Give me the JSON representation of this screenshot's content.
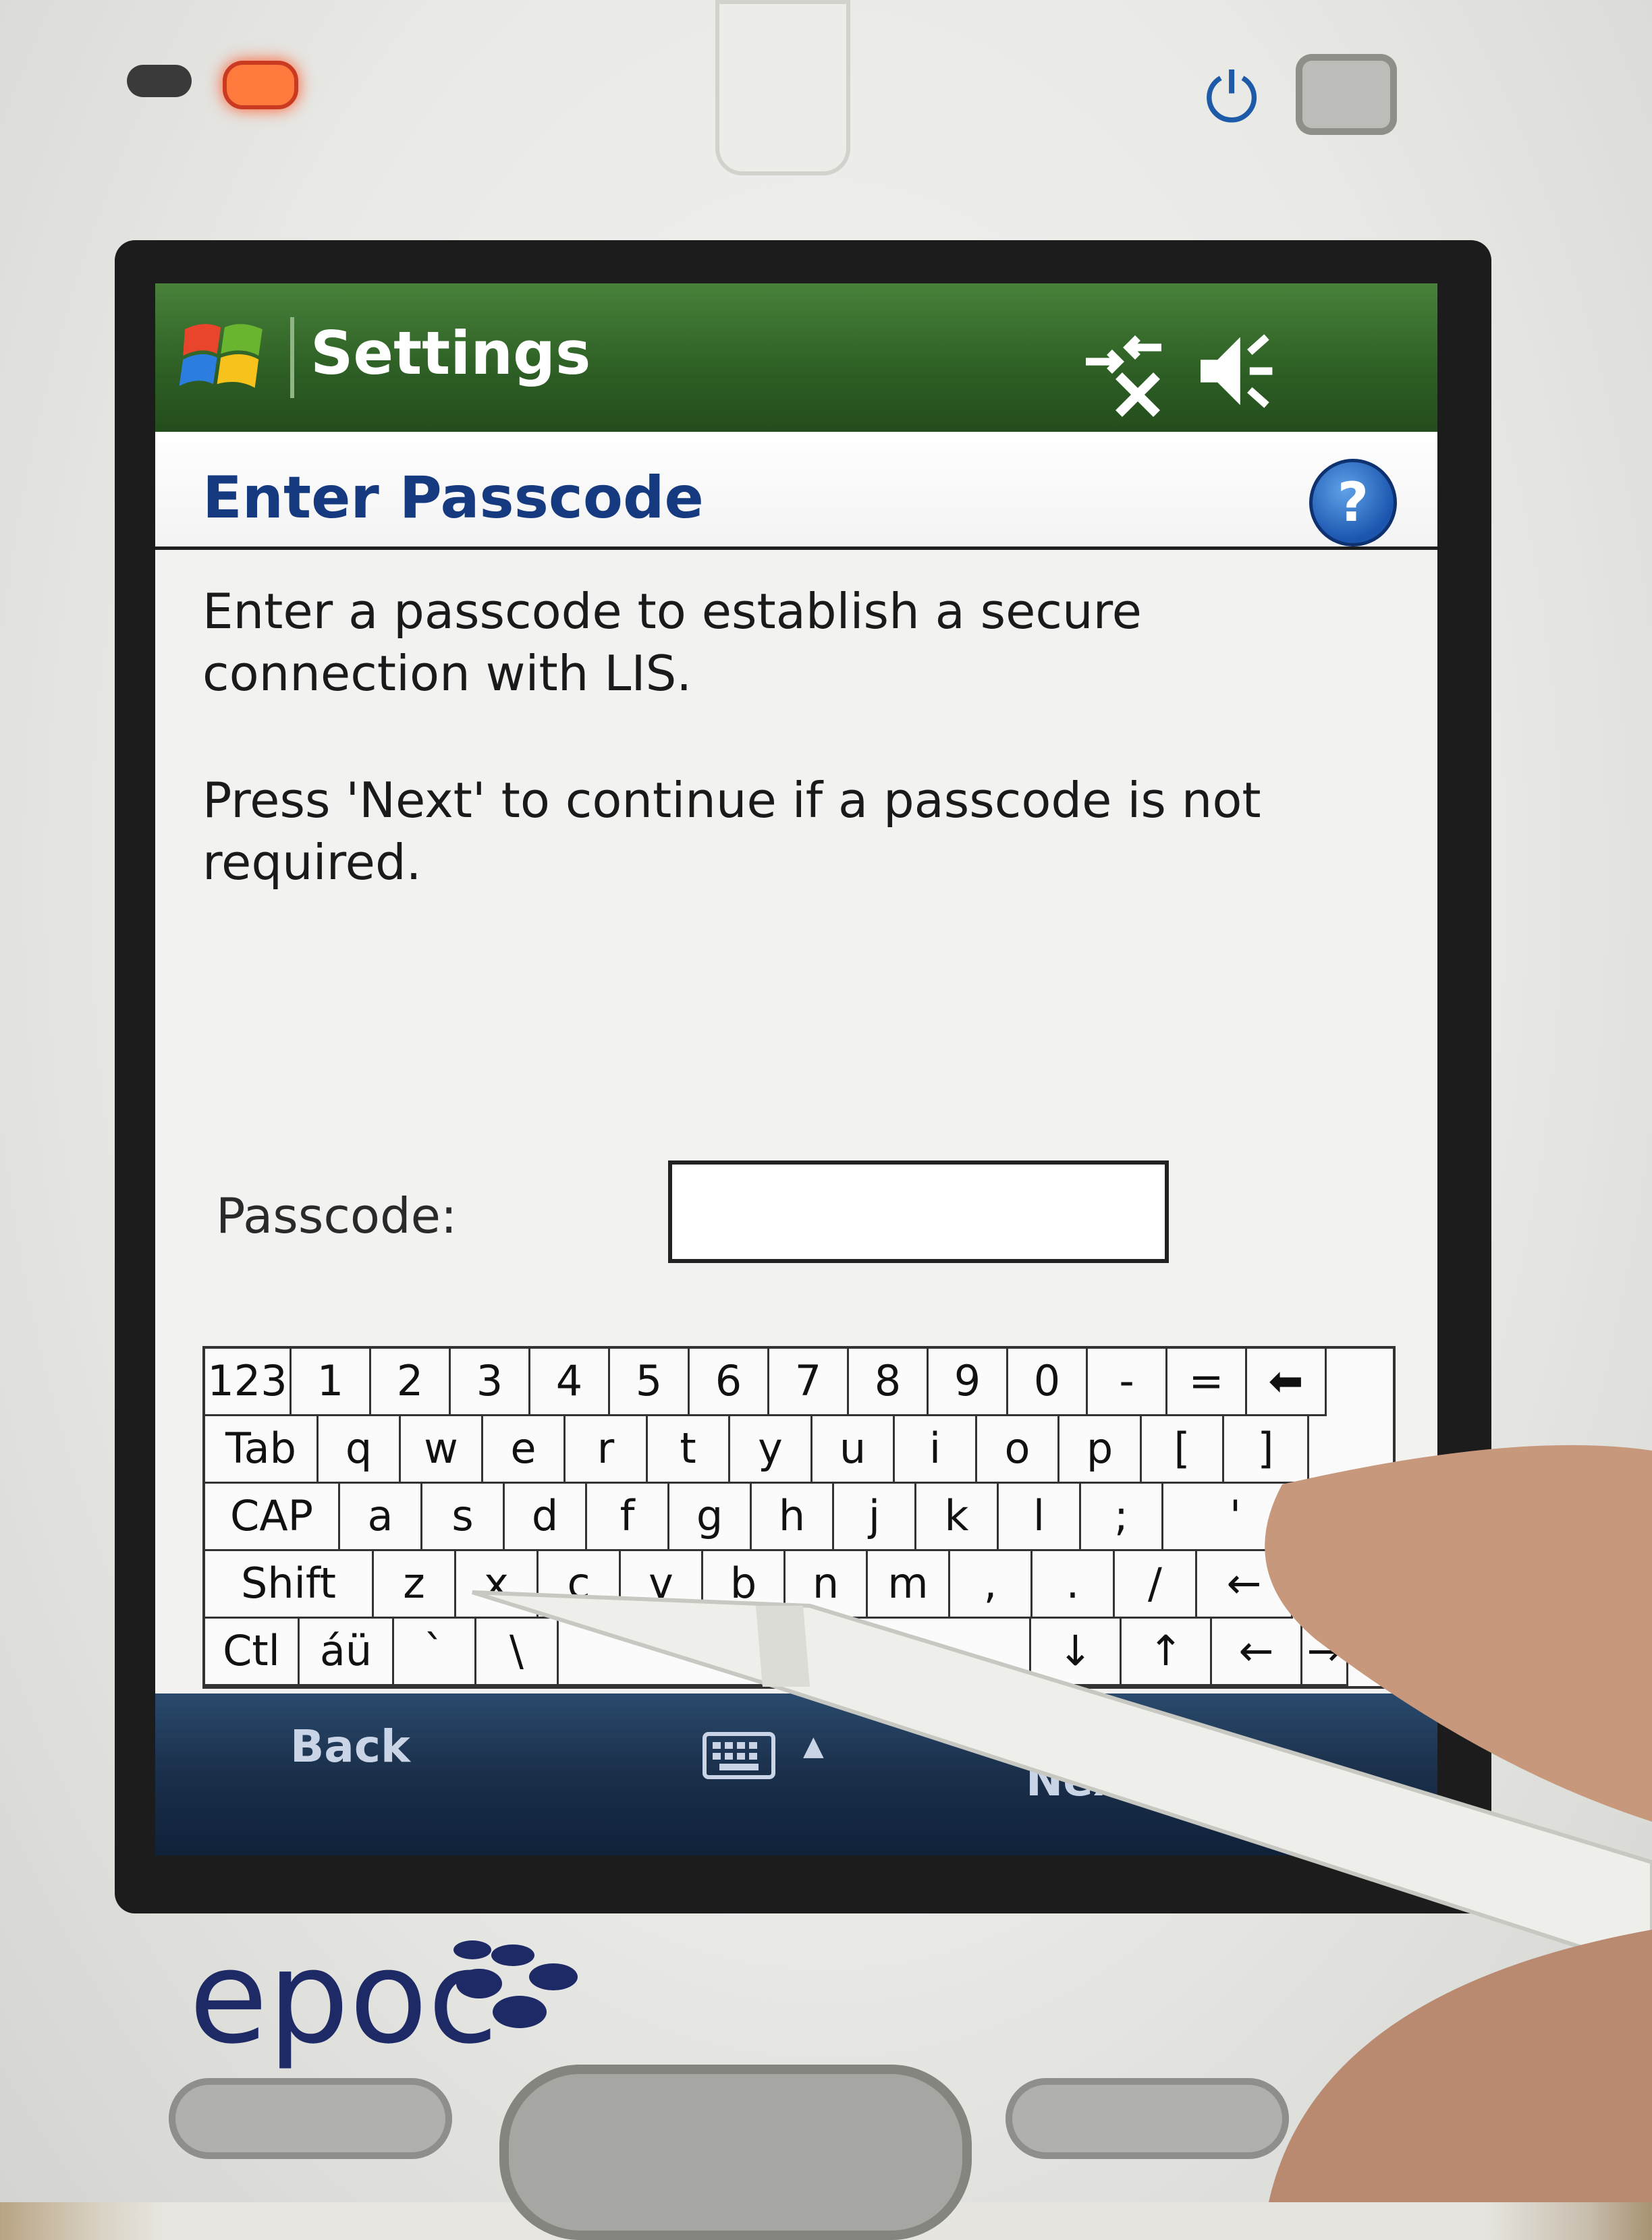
{
  "status_bar": {
    "title": "Settings",
    "icons": [
      "windows-start-icon",
      "connectivity-icon",
      "volume-muted-icon"
    ]
  },
  "header": {
    "title": "Enter Passcode",
    "help_icon": "?"
  },
  "body": {
    "paragraph1": "Enter a passcode to establish a secure connection with LIS.",
    "paragraph2": "Press 'Next' to continue if a passcode is not required."
  },
  "form": {
    "passcode_label": "Passcode:",
    "passcode_value": ""
  },
  "keyboard": {
    "row1": [
      "123",
      "1",
      "2",
      "3",
      "4",
      "5",
      "6",
      "7",
      "8",
      "9",
      "0",
      "-",
      "=",
      "⬅"
    ],
    "row2": [
      "Tab",
      "q",
      "w",
      "e",
      "r",
      "t",
      "y",
      "u",
      "i",
      "o",
      "p",
      "[",
      "]"
    ],
    "row3": [
      "CAP",
      "a",
      "s",
      "d",
      "f",
      "g",
      "h",
      "j",
      "k",
      "l",
      ";",
      "'"
    ],
    "row4": [
      "Shift",
      "z",
      "x",
      "c",
      "v",
      "b",
      "n",
      "m",
      ",",
      ".",
      "/",
      "←"
    ],
    "row5": [
      "Ctl",
      "áü",
      "`",
      "\\",
      " ",
      "↓",
      "↑",
      "←",
      "→"
    ]
  },
  "menubar": {
    "left": "Back",
    "right": "Next",
    "sip_arrow": "▲"
  },
  "device": {
    "brand": "epoc"
  },
  "colors": {
    "title_bar": "#2d5e24",
    "header_text": "#163a80",
    "menu_bar": "#1a2f4a",
    "brand": "#1e2a66"
  }
}
